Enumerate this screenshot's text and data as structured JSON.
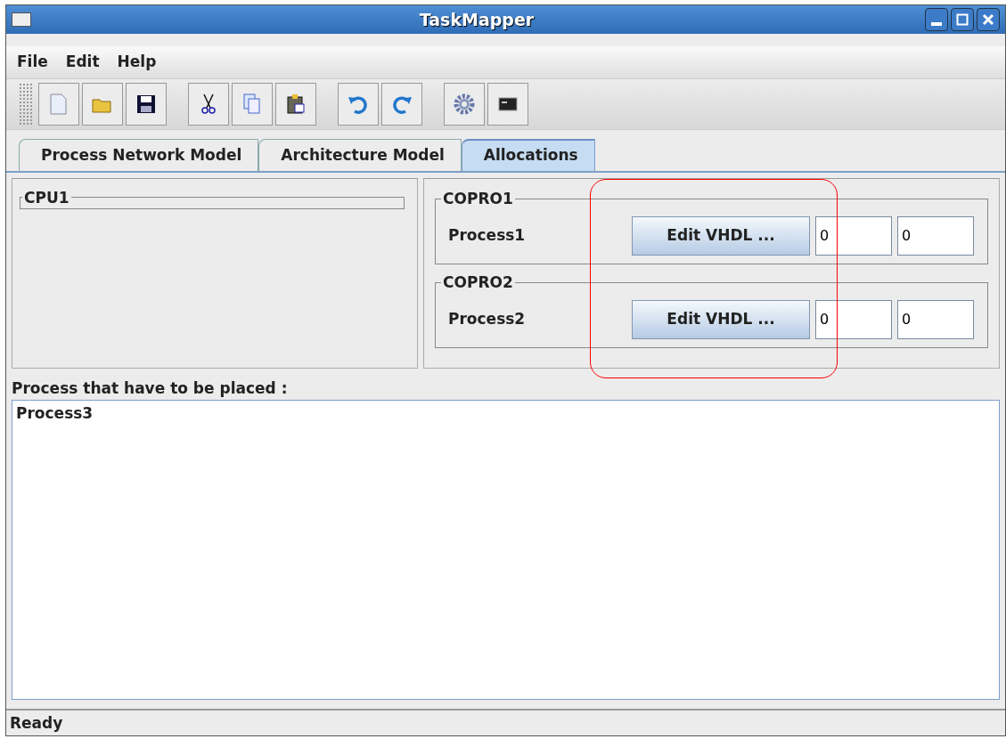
{
  "window": {
    "title": "TaskMapper"
  },
  "menu": [
    "File",
    "Edit",
    "Help"
  ],
  "toolbar": [
    {
      "kind": "new"
    },
    {
      "kind": "open"
    },
    {
      "kind": "save"
    },
    {
      "kind": "sep"
    },
    {
      "kind": "cut"
    },
    {
      "kind": "copy"
    },
    {
      "kind": "paste"
    },
    {
      "kind": "sep"
    },
    {
      "kind": "undo"
    },
    {
      "kind": "redo"
    },
    {
      "kind": "sep"
    },
    {
      "kind": "settings"
    },
    {
      "kind": "terminal"
    }
  ],
  "tabs": [
    {
      "label": "Process Network Model",
      "selected": false
    },
    {
      "label": "Architecture Model",
      "selected": false
    },
    {
      "label": "Allocations",
      "selected": true
    }
  ],
  "cpu": {
    "title": "CPU1"
  },
  "coprocessors": [
    {
      "title": "COPRO1",
      "process": "Process1",
      "button": "Edit VHDL ...",
      "field_1": "0",
      "field_2": "0"
    },
    {
      "title": "COPRO2",
      "process": "Process2",
      "button": "Edit VHDL ...",
      "field_1": "0",
      "field_2": "0"
    }
  ],
  "unplaced": {
    "label": "Process that have to be placed :",
    "items": [
      "Process3"
    ]
  },
  "status_bar": "Ready"
}
